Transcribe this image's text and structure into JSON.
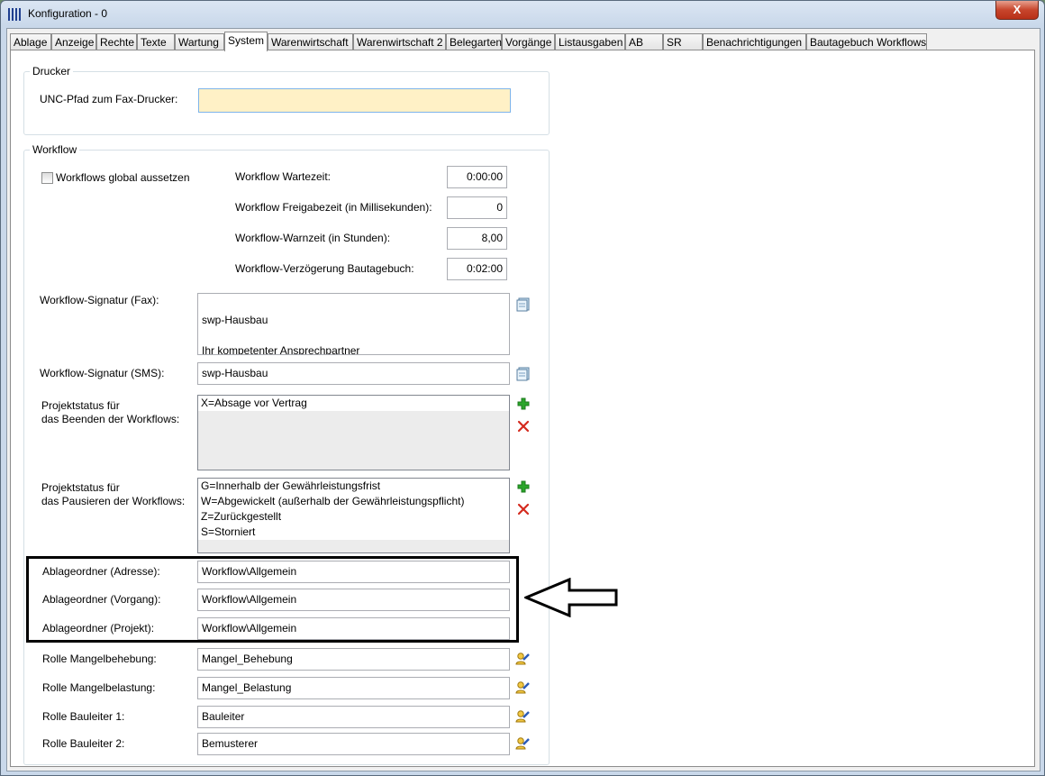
{
  "window": {
    "title": "Konfiguration - 0",
    "close_label": "X"
  },
  "tabs": [
    {
      "label": "Ablage"
    },
    {
      "label": "Anzeige"
    },
    {
      "label": "Rechte"
    },
    {
      "label": "Texte"
    },
    {
      "label": "Wartung"
    },
    {
      "label": "System"
    },
    {
      "label": "Warenwirtschaft"
    },
    {
      "label": "Warenwirtschaft 2"
    },
    {
      "label": "Belegarten"
    },
    {
      "label": "Vorgänge"
    },
    {
      "label": "Listausgaben"
    },
    {
      "label": "AB"
    },
    {
      "label": "SR"
    },
    {
      "label": "Benachrichtigungen"
    },
    {
      "label": "Bautagebuch Workflows"
    }
  ],
  "active_tab": "System",
  "drucker": {
    "legend": "Drucker",
    "fax_printer_label": "UNC-Pfad zum Fax-Drucker:",
    "fax_printer_value": ""
  },
  "workflow": {
    "legend": "Workflow",
    "suspend_label": "Workflows global aussetzen",
    "suspend_checked": false,
    "wait_time_label": "Workflow Wartezeit:",
    "wait_time_value": "0:00:00",
    "release_time_label": "Workflow Freigabezeit (in Millisekunden):",
    "release_time_value": "0",
    "warn_time_label": "Workflow-Warnzeit (in Stunden):",
    "warn_time_value": "8,00",
    "delay_label": "Workflow-Verzögerung Bautagebuch:",
    "delay_value": "0:02:00",
    "signature_fax_label": "Workflow-Signatur (Fax):",
    "signature_fax_lines": [
      "",
      "swp-Hausbau",
      "",
      "Ihr kompetenter Ansprechpartner"
    ],
    "signature_sms_label": "Workflow-Signatur (SMS):",
    "signature_sms_value": "swp-Hausbau",
    "status_end_label_1": "Projektstatus für",
    "status_end_label_2": "das Beenden der Workflows:",
    "status_end_items": [
      "X=Absage vor Vertrag"
    ],
    "status_pause_label_1": "Projektstatus für",
    "status_pause_label_2": "das Pausieren der Workflows:",
    "status_pause_items": [
      "G=Innerhalb der Gewährleistungsfrist",
      "W=Abgewickelt (außerhalb der Gewährleistungspflicht)",
      "Z=Zurückgestellt",
      "S=Storniert"
    ],
    "folder_address_label": "Ablageordner (Adresse):",
    "folder_address_value": "Workflow\\Allgemein",
    "folder_process_label": "Ablageordner (Vorgang):",
    "folder_process_value": "Workflow\\Allgemein",
    "folder_project_label": "Ablageordner (Projekt):",
    "folder_project_value": "Workflow\\Allgemein",
    "role_defect_fix_label": "Rolle Mangelbehebung:",
    "role_defect_fix_value": "Mangel_Behebung",
    "role_defect_charge_label": "Rolle Mangelbelastung:",
    "role_defect_charge_value": "Mangel_Belastung",
    "role_site_mgr1_label": "Rolle Bauleiter 1:",
    "role_site_mgr1_value": "Bauleiter",
    "role_site_mgr2_label": "Rolle Bauleiter 2:",
    "role_site_mgr2_value": "Bemusterer"
  },
  "icons": {
    "notepad": "notepad-icon",
    "add": "plus-icon",
    "remove": "x-icon",
    "user_select": "user-select-icon"
  },
  "colors": {
    "highlight_input": "#fff1c6",
    "add_icon": "#2aa52a",
    "remove_icon": "#d42a1e",
    "close_button": "#c7452c"
  }
}
